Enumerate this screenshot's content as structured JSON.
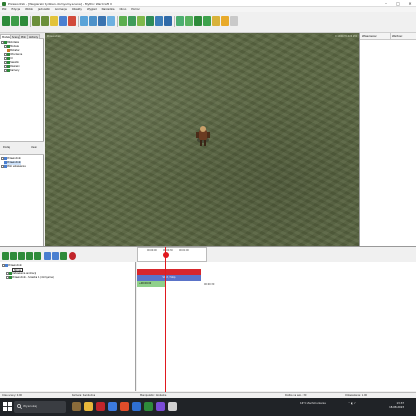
{
  "window": {
    "title": "Przewodnik - [Wegierski tydzien-domyslny.scena] - Mythic WarCraft II",
    "buttons": [
      "–",
      "□",
      "✕"
    ]
  },
  "menu": [
    "Plik",
    "Edycja",
    "Widok",
    "Jednostki",
    "Animacje",
    "Obiekty",
    "Wyglad",
    "Narzedzia",
    "Okno",
    "Pomoc"
  ],
  "left_panel": {
    "tabs": [
      "Modele",
      "Sceny",
      "Pliki",
      "Aktorzy"
    ],
    "tree_top": [
      {
        "label": "Biblioteka",
        "level": 0
      },
      {
        "label": "Modele",
        "level": 1
      },
      {
        "label": "Bohater",
        "level": 2
      },
      {
        "label": "Otoczenie",
        "level": 1
      },
      {
        "label": "UI",
        "level": 1
      },
      {
        "label": "Swiatlo",
        "level": 1
      },
      {
        "label": "Dzwieki",
        "level": 1
      },
      {
        "label": "Kamery",
        "level": 1
      }
    ],
    "mid_buttons": {
      "left": "Dodaj",
      "right": "Usun"
    },
    "tree_bottom": [
      {
        "label": "Przewodnik",
        "level": 0
      },
      {
        "label": "Przewodnik",
        "level": 1,
        "selected": true
      },
      {
        "label": "Pliki ustawienia",
        "level": 0
      }
    ]
  },
  "viewport": {
    "label": "Przewodnik",
    "coords": "X:1024 Y:1024 Z:0"
  },
  "right_panel": {
    "columns": [
      "Wlasciwosc",
      "Wartosc"
    ]
  },
  "timeline": {
    "ruler_ticks": [
      "00:00:00",
      "00:00:30",
      "00:01:00"
    ],
    "tree": [
      {
        "label": "Przewodnik",
        "level": 0
      },
      {
        "label": "Stroje",
        "level": 1
      },
      {
        "label": "Ustawienia animacji",
        "level": 1
      },
      {
        "label": "Przewodnik - Sciezka 1 (domyslna)",
        "level": 1
      }
    ],
    "track": {
      "red_label": "",
      "blue_label": "Start / Stop",
      "green_label": "+00:00:00",
      "end_value": "00:00:30"
    }
  },
  "status": {
    "left": "Czas sceny: 0.00",
    "middle": "Kamera: Swobodna",
    "center": "Manipulator: Globalna",
    "right1": "Klatka na sek.: 30",
    "right2": "Odswiezanie: 1.00"
  },
  "taskbar": {
    "search_placeholder": "Wyszukaj",
    "weather": "16°C Zachmurzenie",
    "time": "13:37",
    "date": "18.08.2023"
  },
  "colors": {
    "accent": "#2e7d32",
    "terrain": "#5c6843",
    "playhead": "#e0191f",
    "track_red": "#d8262b",
    "track_blue": "#5a73c8",
    "track_green": "#8fd08a",
    "taskbar": "#202327"
  }
}
